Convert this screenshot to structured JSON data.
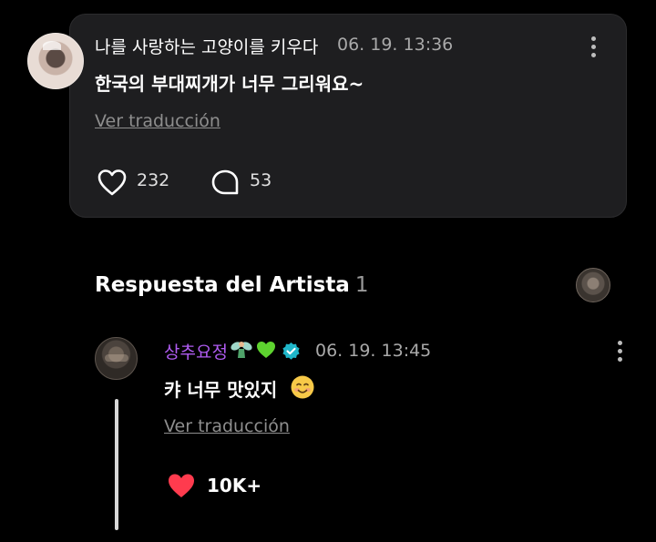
{
  "post": {
    "nickname": "나를 사랑하는 고양이를 키우다",
    "timestamp": "06. 19. 13:36",
    "text": "한국의 부대찌개가 너무 그리워요~",
    "translate_label": "Ver traducción",
    "like_count": "232",
    "comment_count": "53"
  },
  "artist_section": {
    "title": "Respuesta del Artista",
    "count": "1"
  },
  "reply": {
    "artist_name": "상추요정",
    "timestamp": "06. 19. 13:45",
    "text": "캬 너무 맛있지",
    "translate_label": "Ver traducción",
    "like_count": "10K+"
  },
  "icons": {
    "more": "more-vertical-icon",
    "like": "heart-outline-icon",
    "comment": "comment-bubble-icon",
    "liked": "heart-filled-icon",
    "verified": "verified-badge-icon"
  },
  "colors": {
    "background": "#000000",
    "card": "#1e1e20",
    "artist_name": "#b05cf2",
    "liked_heart": "#ff3b4e",
    "verified": "#1fb6c9"
  }
}
